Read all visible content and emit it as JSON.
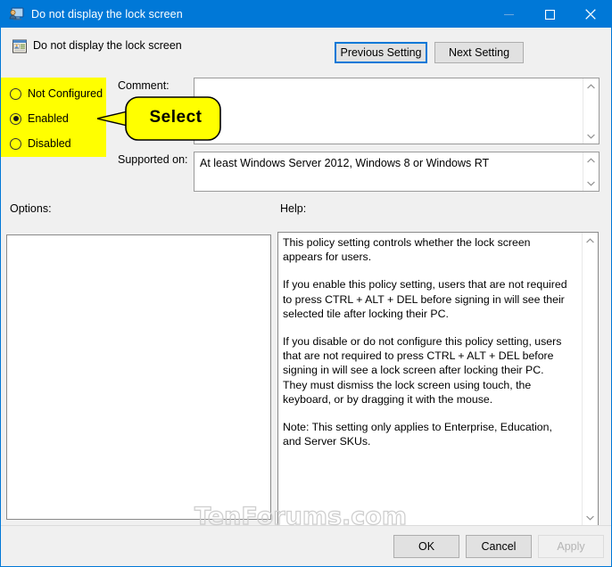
{
  "window": {
    "title": "Do not display the lock screen",
    "title_icon": "lock-screen-policy-icon",
    "minimize_label": "—",
    "maximize_label": "□",
    "close_label": "✕"
  },
  "header": {
    "policy_icon": "group-policy-setting-icon",
    "policy_title": "Do not display the lock screen",
    "previous_setting_label": "Previous Setting",
    "next_setting_label": "Next Setting"
  },
  "state_group": {
    "options": [
      {
        "label": "Not Configured",
        "selected": false
      },
      {
        "label": "Enabled",
        "selected": true
      },
      {
        "label": "Disabled",
        "selected": false
      }
    ],
    "highlight_color": "#ffff00"
  },
  "callout": {
    "text": "Select",
    "fill_color": "#ffff00",
    "border_color": "#000000"
  },
  "fields": {
    "comment_label": "Comment:",
    "comment_value": "",
    "supported_on_label": "Supported on:",
    "supported_on_value": "At least Windows Server 2012, Windows 8 or Windows RT"
  },
  "panels": {
    "options_label": "Options:",
    "options_content": "",
    "help_label": "Help:",
    "help_paragraphs": [
      "This policy setting controls whether the lock screen appears for users.",
      "If you enable this policy setting, users that are not required to press CTRL + ALT + DEL before signing in will see their selected tile after locking their PC.",
      "If you disable or do not configure this policy setting, users that are not required to press CTRL + ALT + DEL before signing in will see a lock screen after locking their PC. They must dismiss the lock screen using touch, the keyboard, or by dragging it with the mouse.",
      "Note: This setting only applies to Enterprise, Education, and Server SKUs."
    ]
  },
  "watermark": {
    "text": "TenForums.com"
  },
  "footer": {
    "ok_label": "OK",
    "cancel_label": "Cancel",
    "apply_label": "Apply",
    "apply_enabled": false
  },
  "colors": {
    "titlebar": "#0078d7",
    "dialog_background": "#f0f0f0",
    "accent": "#0078d7",
    "highlight": "#ffff00"
  }
}
